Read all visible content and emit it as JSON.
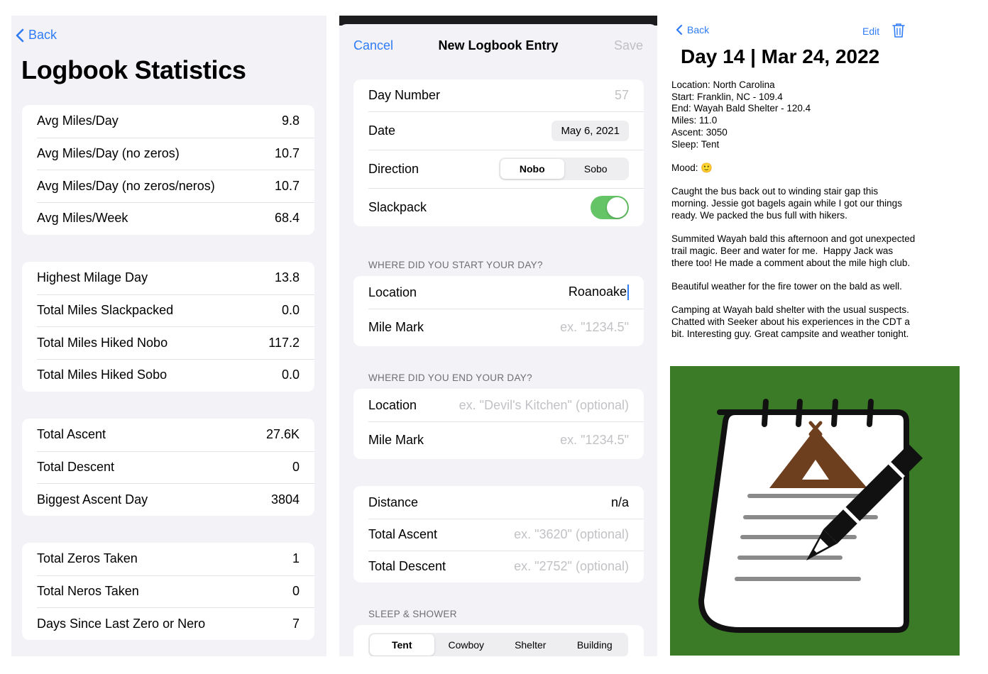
{
  "stats_screen": {
    "back_label": "Back",
    "title": "Logbook Statistics",
    "groups": [
      [
        {
          "label": "Avg Miles/Day",
          "value": "9.8"
        },
        {
          "label": "Avg Miles/Day (no zeros)",
          "value": "10.7"
        },
        {
          "label": "Avg Miles/Day (no zeros/neros)",
          "value": "10.7"
        },
        {
          "label": "Avg Miles/Week",
          "value": "68.4"
        }
      ],
      [
        {
          "label": "Highest Milage Day",
          "value": "13.8"
        },
        {
          "label": "Total Miles Slackpacked",
          "value": "0.0"
        },
        {
          "label": "Total Miles Hiked Nobo",
          "value": "117.2"
        },
        {
          "label": "Total Miles Hiked Sobo",
          "value": "0.0"
        }
      ],
      [
        {
          "label": "Total Ascent",
          "value": "27.6K"
        },
        {
          "label": "Total Descent",
          "value": "0"
        },
        {
          "label": "Biggest Ascent Day",
          "value": "3804"
        }
      ],
      [
        {
          "label": "Total Zeros Taken",
          "value": "1"
        },
        {
          "label": "Total Neros Taken",
          "value": "0"
        },
        {
          "label": "Days Since Last Zero or Nero",
          "value": "7"
        }
      ]
    ]
  },
  "entry_screen": {
    "cancel_label": "Cancel",
    "title": "New Logbook Entry",
    "save_label": "Save",
    "day_number": {
      "label": "Day Number",
      "placeholder": "57"
    },
    "date": {
      "label": "Date",
      "value": "May 6, 2021"
    },
    "direction": {
      "label": "Direction",
      "options": [
        "Nobo",
        "Sobo"
      ],
      "selected": "Nobo"
    },
    "slackpack": {
      "label": "Slackpack",
      "on": true
    },
    "start_section": {
      "header": "WHERE DID YOU START YOUR DAY?",
      "location_label": "Location",
      "location_value": "Roanoake",
      "mile_label": "Mile Mark",
      "mile_placeholder": "ex. \"1234.5\""
    },
    "end_section": {
      "header": "WHERE DID YOU END YOUR DAY?",
      "location_label": "Location",
      "location_placeholder": "ex. \"Devil's Kitchen\" (optional)",
      "mile_label": "Mile Mark",
      "mile_placeholder": "ex. \"1234.5\""
    },
    "metrics": {
      "distance_label": "Distance",
      "distance_value": "n/a",
      "ascent_label": "Total Ascent",
      "ascent_placeholder": "ex. \"3620\" (optional)",
      "descent_label": "Total Descent",
      "descent_placeholder": "ex. \"2752\" (optional)"
    },
    "sleep_section": {
      "header": "SLEEP & SHOWER",
      "options": [
        "Tent",
        "Cowboy",
        "Shelter",
        "Building"
      ],
      "selected": "Tent"
    }
  },
  "day_screen": {
    "back_label": "Back",
    "edit_label": "Edit",
    "title": "Day 14 | Mar 24, 2022",
    "details": [
      "Location: North Carolina",
      "Start: Franklin, NC - 109.4",
      "End: Wayah Bald Shelter - 120.4",
      "Miles: 11.0",
      "Ascent: 3050",
      "Sleep: Tent"
    ],
    "mood_label": "Mood:",
    "mood_emoji": "🙂",
    "paragraphs": [
      "Caught the bus back out to winding stair gap this morning. Jessie got bagels again while I got our things ready. We packed the bus full with hikers.",
      "Summited Wayah bald this afternoon and got unexpected trail magic. Beer and water for me.  Happy Jack was there too! He made a comment about the mile high club.",
      "Beautiful weather for the fire tower on the bald as well.",
      "Camping at Wayah bald shelter with the usual suspects. Chatted with Seeker about his experiences in the CDT a bit. Interesting guy. Great campsite and weather tonight."
    ]
  },
  "colors": {
    "accent": "#2f7cf6",
    "toggle_on": "#65c466",
    "art_background": "#3b7a26",
    "tent": "#6e3f1f"
  }
}
